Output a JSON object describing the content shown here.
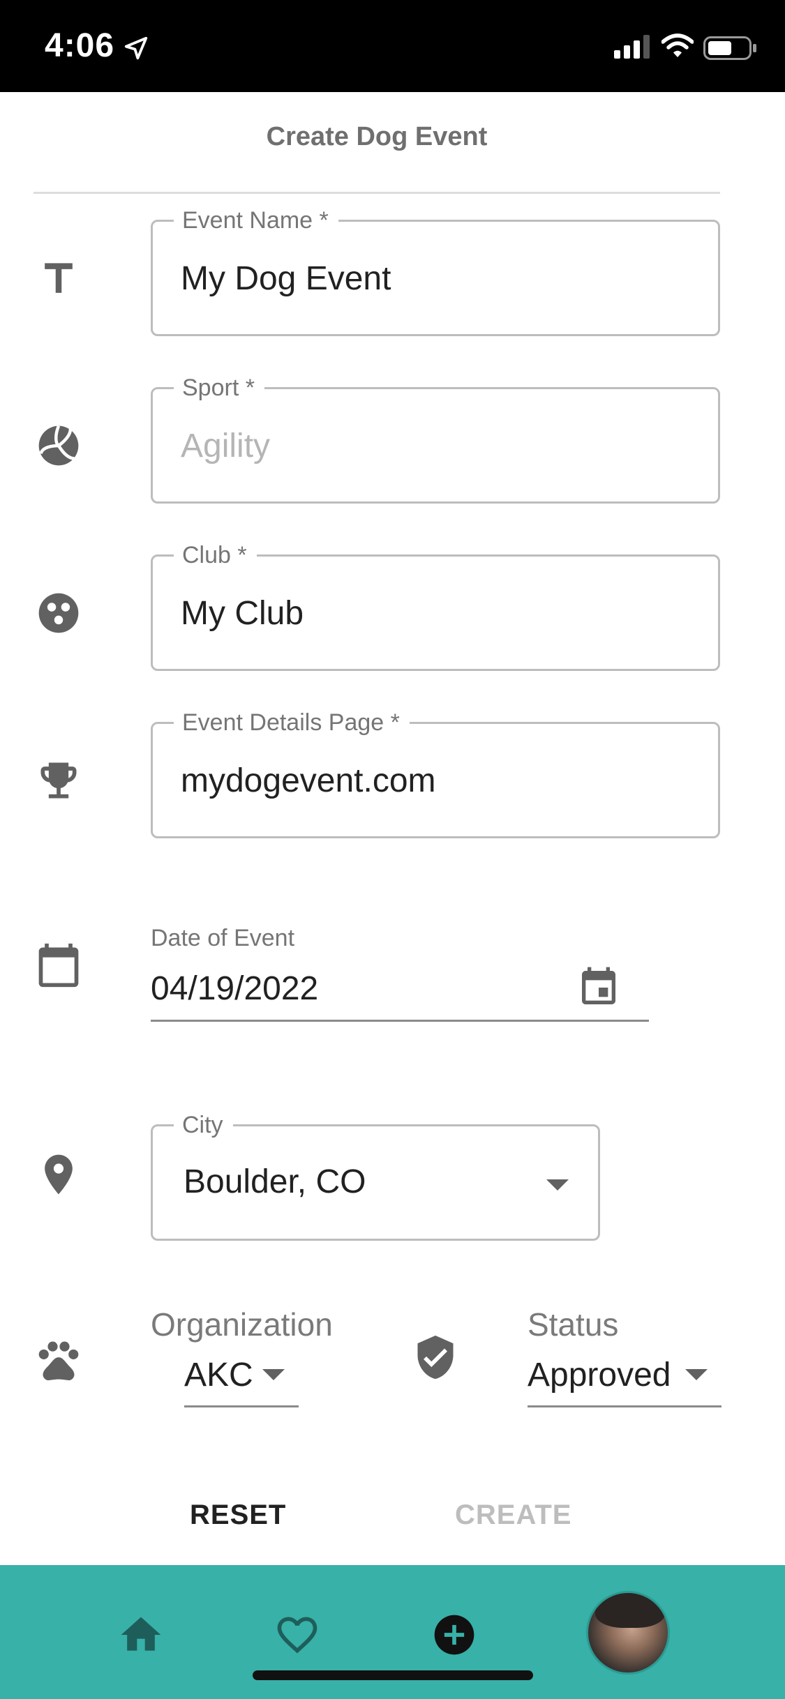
{
  "status_bar": {
    "time": "4:06"
  },
  "header": {
    "title": "Create Dog Event"
  },
  "form": {
    "event_name": {
      "label": "Event Name *",
      "value": "My Dog Event",
      "icon": "title-icon"
    },
    "sport": {
      "label": "Sport *",
      "value": "Agility",
      "icon": "volleyball-icon"
    },
    "club": {
      "label": "Club *",
      "value": "My Club",
      "icon": "group-icon"
    },
    "details_page": {
      "label": "Event Details Page *",
      "value": "mydogevent.com",
      "icon": "trophy-icon"
    },
    "date": {
      "label": "Date of Event",
      "value": "04/19/2022",
      "icon": "calendar-icon"
    },
    "city": {
      "label": "City",
      "value": "Boulder, CO",
      "icon": "location-pin-icon"
    },
    "organization": {
      "label": "Organization",
      "value": "AKC",
      "icon": "paw-icon"
    },
    "status": {
      "label": "Status",
      "value": "Approved",
      "icon": "shield-check-icon"
    }
  },
  "actions": {
    "reset_label": "RESET",
    "create_label": "CREATE"
  },
  "bottom_nav": {
    "items": [
      "home-icon",
      "heart-icon",
      "add-circle-icon",
      "avatar"
    ]
  },
  "colors": {
    "nav_background": "#38b1a8",
    "icon_gray": "#616161",
    "nav_icon": "#1e5e5a"
  }
}
